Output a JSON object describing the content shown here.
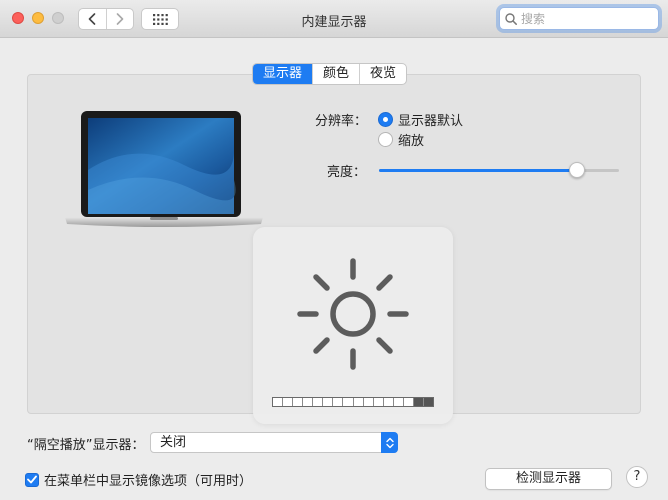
{
  "window": {
    "title": "内建显示器"
  },
  "search": {
    "placeholder": "搜索"
  },
  "tabs": [
    {
      "label": "显示器",
      "active": true
    },
    {
      "label": "颜色",
      "active": false
    },
    {
      "label": "夜览",
      "active": false
    }
  ],
  "resolution": {
    "label": "分辨率：",
    "options": [
      {
        "label": "显示器默认",
        "selected": true
      },
      {
        "label": "缩放",
        "selected": false
      }
    ]
  },
  "brightness": {
    "label": "亮度：",
    "value": 0.85
  },
  "hud": {
    "level": 0.875,
    "segments": 16
  },
  "airplay": {
    "label": "“隔空播放”显示器：",
    "selected": "关闭"
  },
  "mirror_option": {
    "label": "在菜单栏中显示镜像选项（可用时）",
    "checked": true
  },
  "detect_button": {
    "label": "检测显示器"
  },
  "help_button": {
    "label": "?"
  },
  "colors": {
    "accent": "#1e7cf2"
  }
}
